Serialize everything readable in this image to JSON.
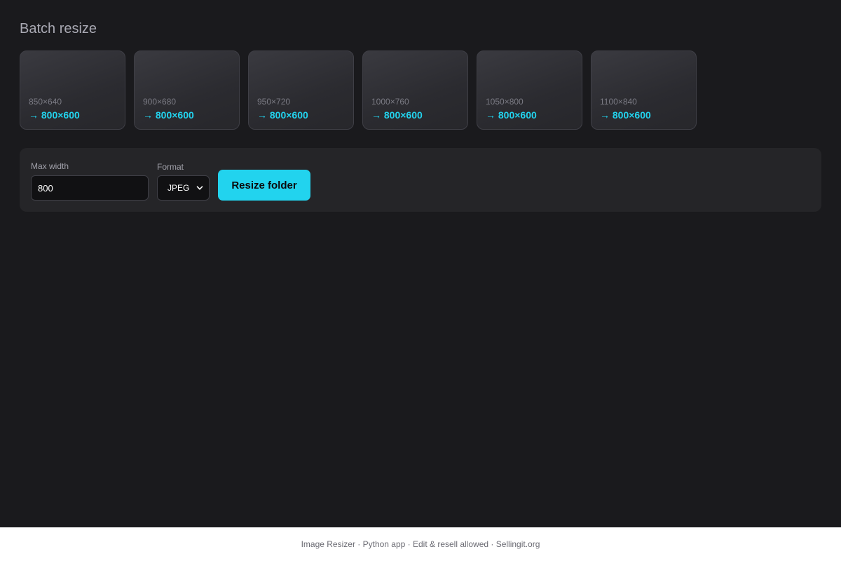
{
  "app": {
    "title": "Batch resize"
  },
  "tiles": [
    {
      "original": "850×640",
      "target": "→ 800×600"
    },
    {
      "original": "900×680",
      "target": "→ 800×600"
    },
    {
      "original": "950×720",
      "target": "→ 800×600"
    },
    {
      "original": "1000×760",
      "target": "→ 800×600"
    },
    {
      "original": "1050×800",
      "target": "→ 800×600"
    },
    {
      "original": "1100×840",
      "target": "→ 800×600"
    }
  ],
  "controls": {
    "max_width_label": "Max width",
    "max_width_value": "800",
    "format_label": "Format",
    "format_selected": "JPEG",
    "resize_button_label": "Resize folder"
  },
  "footer": {
    "text": "Image Resizer · Python app · Edit & resell allowed · ",
    "link_label": "Sellingit.org"
  },
  "colors": {
    "background": "#1a1a1d",
    "panel": "#252528",
    "accent": "#22d3ee"
  },
  "icons": {
    "format_dropdown": "chevron-down-icon"
  }
}
